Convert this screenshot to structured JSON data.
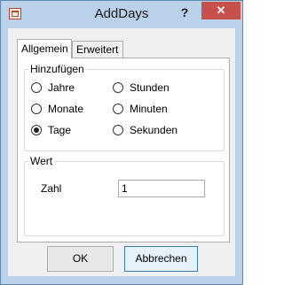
{
  "window": {
    "title": "AddDays",
    "help": "?",
    "close": "✕"
  },
  "tabs": [
    {
      "label": "Allgemein"
    },
    {
      "label": "Erweitert"
    }
  ],
  "groups": {
    "hinzufuegen": {
      "legend": "Hinzufügen",
      "options": [
        {
          "label": "Jahre",
          "checked": false
        },
        {
          "label": "Monate",
          "checked": false
        },
        {
          "label": "Tage",
          "checked": true
        },
        {
          "label": "Stunden",
          "checked": false
        },
        {
          "label": "Minuten",
          "checked": false
        },
        {
          "label": "Sekunden",
          "checked": false
        }
      ]
    },
    "wert": {
      "legend": "Wert",
      "field_label": "Zahl",
      "value": "1"
    }
  },
  "buttons": {
    "ok": "OK",
    "cancel": "Abbrechen"
  }
}
